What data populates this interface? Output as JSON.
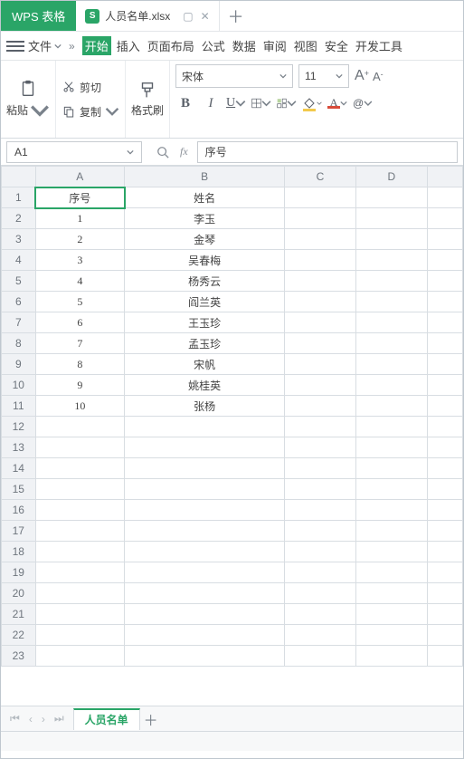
{
  "app": {
    "wps_label": "WPS 表格",
    "file_name": "人员名单.xlsx"
  },
  "menu": {
    "file": "文件",
    "tabs": [
      "开始",
      "插入",
      "页面布局",
      "公式",
      "数据",
      "审阅",
      "视图",
      "安全",
      "开发工具"
    ]
  },
  "toolbar": {
    "paste": "粘贴",
    "cut": "剪切",
    "copy": "复制",
    "format_painter": "格式刷",
    "font_name": "宋体",
    "font_size": "11"
  },
  "fx": {
    "cell_ref": "A1",
    "fx_label": "fx",
    "formula_value": "序号"
  },
  "columns": [
    "A",
    "B",
    "C",
    "D",
    ""
  ],
  "row_count": 23,
  "headers": {
    "a": "序号",
    "b": "姓名"
  },
  "chart_data": {
    "type": "table",
    "title": "人员名单",
    "columns": [
      "序号",
      "姓名"
    ],
    "rows": [
      {
        "序号": 1,
        "姓名": "李玉"
      },
      {
        "序号": 2,
        "姓名": "金琴"
      },
      {
        "序号": 3,
        "姓名": "吴春梅"
      },
      {
        "序号": 4,
        "姓名": "杨秀云"
      },
      {
        "序号": 5,
        "姓名": "阎兰英"
      },
      {
        "序号": 6,
        "姓名": "王玉珍"
      },
      {
        "序号": 7,
        "姓名": "孟玉珍"
      },
      {
        "序号": 8,
        "姓名": "宋帆"
      },
      {
        "序号": 9,
        "姓名": "姚桂英"
      },
      {
        "序号": 10,
        "姓名": "张杨"
      }
    ]
  },
  "sheet": {
    "active": "人员名单"
  }
}
